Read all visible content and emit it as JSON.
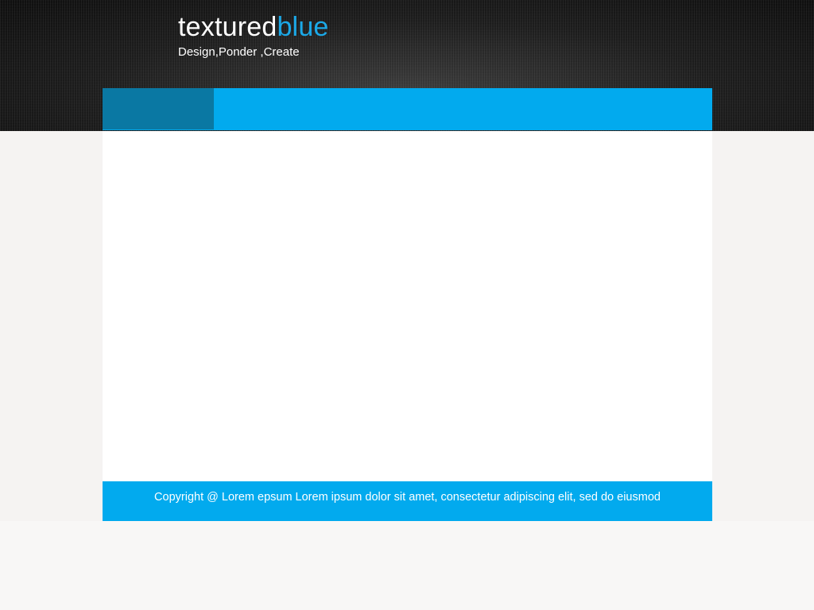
{
  "header": {
    "logo_part1": "textured",
    "logo_part2": "blue",
    "tagline": "Design,Ponder ,Create"
  },
  "nav": {
    "items": [
      {
        "label": ""
      }
    ]
  },
  "footer": {
    "copyright": "Copyright @ Lorem epsum Lorem ipsum dolor sit amet, consectetur adipiscing elit, sed do eiusmod"
  },
  "colors": {
    "accent": "#02aaee",
    "active_nav": "#0a78a3",
    "logo_blue": "#1ba9e8",
    "header_bg": "#141414",
    "page_bg": "#f5f3f2",
    "content_bg": "#ffffff"
  }
}
